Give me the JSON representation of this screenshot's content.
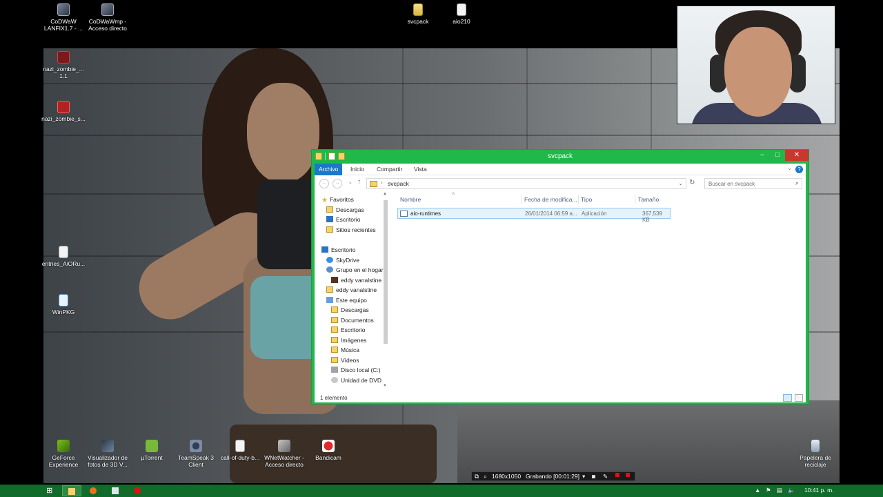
{
  "desktop": {
    "icons_top": [
      {
        "label": "CoDWaW LANFIX1.7 - ...",
        "icon": "game-icon"
      },
      {
        "label": "CoDWaWmp - Acceso directo",
        "icon": "game-icon"
      },
      {
        "label": "svcpack",
        "icon": "zip-folder-icon"
      },
      {
        "label": "aio210",
        "icon": "document-icon"
      }
    ],
    "icons_left": [
      {
        "label": "nazi_zombie_... 1.1",
        "icon": "ugx-icon"
      },
      {
        "label": "nazi_zombie_s...",
        "icon": "map-icon"
      },
      {
        "label": "entries_AiORu...",
        "icon": "file-icon"
      },
      {
        "label": "WinPKG",
        "icon": "package-icon"
      }
    ],
    "icons_bottom": [
      {
        "label": "GeForce Experience",
        "icon": "nvidia-icon"
      },
      {
        "label": "Visualizador de fotos de 3D V...",
        "icon": "3d-viewer-icon"
      },
      {
        "label": "µTorrent",
        "icon": "utorrent-icon"
      },
      {
        "label": "TeamSpeak 3 Client",
        "icon": "teamspeak-icon"
      },
      {
        "label": "call-of-duty-b...",
        "icon": "file-icon"
      },
      {
        "label": "WNetWatcher - Acceso directo",
        "icon": "network-icon"
      },
      {
        "label": "Bandicam",
        "icon": "bandicam-icon"
      }
    ],
    "recycle_bin": {
      "label": "Papelera de reciclaje",
      "icon": "recycle-bin-icon"
    }
  },
  "explorer": {
    "title": "svcpack",
    "ribbon_tabs": [
      {
        "label": "Archivo",
        "active": true
      },
      {
        "label": "Inicio",
        "active": false
      },
      {
        "label": "Compartir",
        "active": false
      },
      {
        "label": "Vista",
        "active": false
      }
    ],
    "address_path": "svcpack",
    "search_placeholder": "Buscar en svcpack",
    "nav_pane": [
      {
        "label": "Favoritos",
        "icon": "star-icon",
        "indent": 0
      },
      {
        "label": "Descargas",
        "icon": "downloads-folder-icon",
        "indent": 1
      },
      {
        "label": "Escritorio",
        "icon": "desktop-icon",
        "indent": 1
      },
      {
        "label": "Sitios recientes",
        "icon": "recent-places-icon",
        "indent": 1
      },
      {
        "label": "Escritorio",
        "icon": "desktop-icon",
        "indent": 0,
        "gap": true
      },
      {
        "label": "SkyDrive",
        "icon": "skydrive-icon",
        "indent": 1
      },
      {
        "label": "Grupo en el hogar",
        "icon": "homegroup-icon",
        "indent": 1
      },
      {
        "label": "eddy vanalstine",
        "icon": "user-photo-icon",
        "indent": 2
      },
      {
        "label": "eddy vanalstine",
        "icon": "user-folder-icon",
        "indent": 1
      },
      {
        "label": "Este equipo",
        "icon": "computer-icon",
        "indent": 1
      },
      {
        "label": "Descargas",
        "icon": "downloads-folder-icon",
        "indent": 2
      },
      {
        "label": "Documentos",
        "icon": "documents-folder-icon",
        "indent": 2
      },
      {
        "label": "Escritorio",
        "icon": "desktop-folder-icon",
        "indent": 2
      },
      {
        "label": "Imágenes",
        "icon": "pictures-folder-icon",
        "indent": 2
      },
      {
        "label": "Música",
        "icon": "music-folder-icon",
        "indent": 2
      },
      {
        "label": "Vídeos",
        "icon": "videos-folder-icon",
        "indent": 2
      },
      {
        "label": "Disco local (C:)",
        "icon": "local-disk-icon",
        "indent": 2
      },
      {
        "label": "Unidad de DVD",
        "icon": "dvd-drive-icon",
        "indent": 2
      }
    ],
    "columns": [
      "Nombre",
      "Fecha de modifica...",
      "Tipo",
      "Tamaño"
    ],
    "files": [
      {
        "name": "aio-runtimes",
        "date": "26/01/2014 06:59 a...",
        "type": "Aplicación",
        "size": "367,539 KB"
      }
    ],
    "status": "1 elemento"
  },
  "bandicam": {
    "resolution": "1680x1050",
    "recording": "Grabando [00:01:29]"
  },
  "taskbar": {
    "clock": "10:41 p. m.",
    "pinned": [
      {
        "name": "file-explorer",
        "active": true
      },
      {
        "name": "firefox",
        "active": false
      },
      {
        "name": "window-app",
        "active": false
      },
      {
        "name": "bandicam",
        "active": false
      }
    ]
  },
  "colors": {
    "window_accent": "#1fb849",
    "taskbar": "#116b2a",
    "ribbon_active": "#1979ca",
    "close_button": "#c7382d"
  }
}
